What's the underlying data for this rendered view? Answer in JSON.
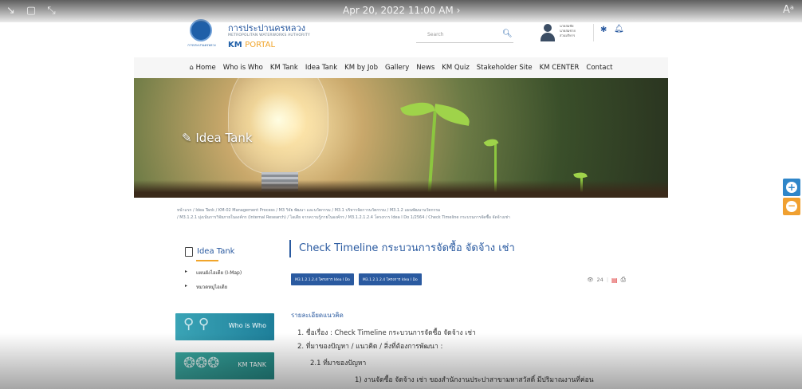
{
  "os_bar": {
    "datetime": "Apr 20, 2022 11:00 AM",
    "left_icons": [
      "↘",
      "▢",
      "⤡"
    ],
    "right_icon": "Aᵃ"
  },
  "header": {
    "org_name_th": "การประปานครหลวง",
    "org_name_en": "METROPOLITAN WATERWORKS AUTHORITY",
    "km_label": "KM",
    "portal_label": "PORTAL",
    "logo_caption": "การประปานครหลวง",
    "search_placeholder": "Search",
    "user_lines": [
      "นายสมชัย",
      "นายสมชาย",
      "ส่วนบริหาร"
    ]
  },
  "nav": {
    "items": [
      "Home",
      "Who is Who",
      "KM Tank",
      "Idea Tank",
      "KM by Job",
      "Gallery",
      "News",
      "KM Quiz",
      "Stakeholder Site",
      "KM CENTER",
      "Contact"
    ]
  },
  "banner": {
    "title": "Idea Tank"
  },
  "breadcrumb": {
    "line1": "หน้าแรก / Idea Tank / KM-02 Management Process / M3 วิจัย พัฒนา และนวัตกรรม / M3.1 บริหารจัดการนวัตกรรม / M3.1.2 แผนพัฒนานวัตกรรม",
    "line2": "/ M3.1.2.1 มุ่งเน้นการวิจัยภายในองค์กร (Internal Research) / ไอเดีย จากความรู้ภายในองค์กร / M3.1.2.1.2.4 โครงการ Idea I Do 1/2564 / Check Timeline กระบวนการจัดซื้อ จัดจ้างเช่า"
  },
  "sidebar": {
    "title": "Idea Tank",
    "items": [
      "แผนผังไอเดีย (I-Map)",
      "หมวดหมู่ไอเดีย"
    ],
    "promos": [
      "Who is Who",
      "KM TANK"
    ]
  },
  "main": {
    "title": "Check Timeline กระบวนการจัดซื้อ จัดจ้าง เช่า",
    "tags": [
      "M3.1.2.1.2.4 โครงการ Idea I Do",
      "M3.1.2.1.2.4 โครงการ Idea I Do"
    ],
    "views": "24",
    "section_heading": "รายละเอียดแนวคิด",
    "lines": [
      "1. ชื่อเรื่อง :      Check Timeline กระบวนการจัดซื้อ จัดจ้าง เช่า",
      "2. ที่มาของปัญหา / แนวคิด / สิ่งที่ต้องการพัฒนา :",
      "2.1 ที่มาของปัญหา",
      "1) งานจัดซื้อ จัดจ้าง เช่า ของสำนักงานประปาสาขามหาสวัสดิ์ มีปริมาณงานที่ค่อน"
    ]
  },
  "colors": {
    "brand_blue": "#2a5aa0",
    "accent_orange": "#f1a52b",
    "float_blue": "#2f86c9",
    "float_orange": "#f0a030"
  }
}
